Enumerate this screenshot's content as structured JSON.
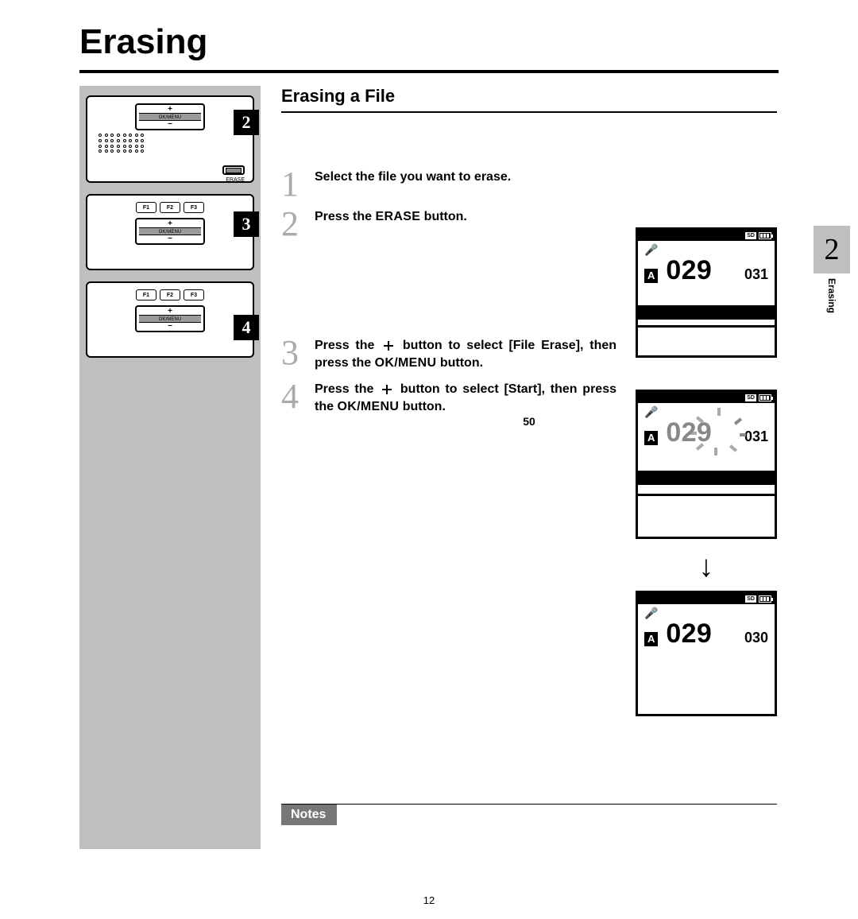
{
  "page": {
    "title": "Erasing",
    "section": "Erasing a File",
    "inner_page_num": "50",
    "outer_page_num": "12",
    "notes_label": "Notes"
  },
  "side_tab": {
    "num": "2",
    "label": "Erasing"
  },
  "diagram_labels": {
    "f1": "F1",
    "f2": "F2",
    "f3": "F3",
    "ok_menu": "OK/MENU",
    "erase": "ERASE",
    "plus": "+",
    "minus": "–",
    "tag2": "2",
    "tag3": "3",
    "tag4": "4"
  },
  "steps": {
    "s1": {
      "num": "1",
      "text": "Select the file you want to erase."
    },
    "s2": {
      "num": "2",
      "text_a": "Press the ",
      "btn": "ERASE",
      "text_b": " button."
    },
    "s3": {
      "num": "3",
      "text_a": "Press the ",
      "text_b": " button to select [File Erase], then press the ",
      "btn": "OK/MENU",
      "text_c": " button."
    },
    "s4": {
      "num": "4",
      "text_a": "Press the ",
      "text_b": " button to select [Start], then press the ",
      "btn": "OK/MENU",
      "text_c": " button."
    }
  },
  "screens": {
    "sd": "SD",
    "folder": "A",
    "sc1": {
      "big": "029",
      "small": "031"
    },
    "sc2": {
      "big": "029",
      "small": "031"
    },
    "sc3": {
      "big": "029",
      "small": "030"
    },
    "arrow": "↓"
  }
}
